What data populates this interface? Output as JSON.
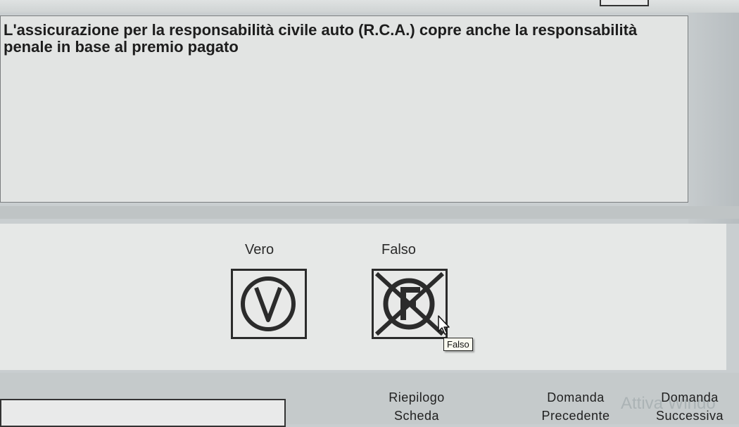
{
  "question": {
    "text": "L'assicurazione per la responsabilità civile auto (R.C.A.) copre anche la responsabilità penale in base al premio pagato"
  },
  "answers": {
    "true_label": "Vero",
    "false_label": "Falso",
    "tooltip": "Falso"
  },
  "navigation": {
    "riepilogo_line1": "Riepilogo",
    "riepilogo_line2": "Scheda",
    "precedente_line1": "Domanda",
    "precedente_line2": "Precedente",
    "successiva_line1": "Domanda",
    "successiva_line2": "Successiva"
  },
  "watermark": "Attiva Windo"
}
